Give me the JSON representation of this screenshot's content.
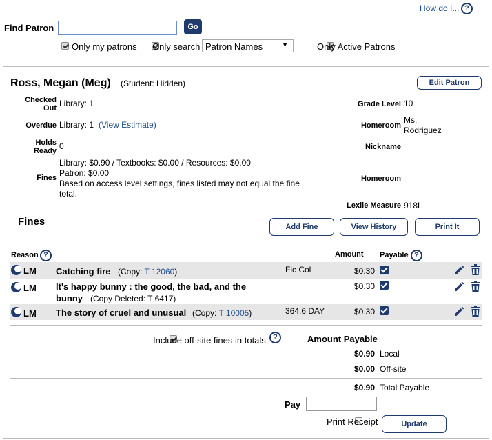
{
  "header": {
    "how_do_i": "How do I...",
    "find_patron_label": "Find Patron",
    "go_label": "Go",
    "only_my_patrons": "Only my patrons",
    "only_search": "Only search",
    "search_select": "Patron Names",
    "only_active": "Only Active Patrons"
  },
  "patron": {
    "name": "Ross, Megan (Meg)",
    "type": "(Student: Hidden)",
    "edit_label": "Edit Patron",
    "checked_out_label_1": "Checked",
    "checked_out_label_2": "Out",
    "checked_out_value": "Library: 1",
    "overdue_label": "Overdue",
    "overdue_value": "Library: 1",
    "view_estimate": "(View Estimate)",
    "holds_label_1": "Holds",
    "holds_label_2": "Ready",
    "holds_value": "0",
    "fines_label": "Fines",
    "fines_line1": "Library: $0.90 / Textbooks: $0.00 / Resources: $0.00",
    "fines_line2": "Patron: $0.00",
    "fines_line3": "Based on access level settings, fines listed may not equal the fine",
    "fines_line4": "total.",
    "grade_label": "Grade Level",
    "grade_value": "10",
    "homeroom_label": "Homeroom",
    "homeroom_value_1": "Ms.",
    "homeroom_value_2": "Rodriguez",
    "nickname_label": "Nickname",
    "homeroom2_label": "Homeroom",
    "lexile_label": "Lexile Measure",
    "lexile_value": "918L"
  },
  "fines": {
    "title": "Fines",
    "add_fine": "Add Fine",
    "view_history": "View History",
    "print_it": "Print It",
    "col_reason": "Reason",
    "col_amount": "Amount",
    "col_payable": "Payable",
    "rows": [
      {
        "reason": "LM",
        "title": "Catching fire",
        "copy_prefix": "(Copy: ",
        "copy": "T 12060",
        "copy_suffix": ")",
        "call": "Fic Col",
        "amount": "$0.30"
      },
      {
        "reason": "LM",
        "title_1": "It's happy bunny : the good, the bad, and the",
        "title_2": "bunny",
        "copy_text": "(Copy Deleted: T 6417)",
        "amount": "$0.30"
      },
      {
        "reason": "LM",
        "title": "The story of cruel and unusual",
        "copy_prefix": "(Copy: ",
        "copy": "T 10005",
        "copy_suffix": ")",
        "call": "364.6 DAY",
        "amount": "$0.30"
      }
    ]
  },
  "totals": {
    "include_offsite": "Include off-site fines in totals",
    "amount_payable": "Amount Payable",
    "local_amount": "$0.90",
    "local_label": "Local",
    "offsite_amount": "$0.00",
    "offsite_label": "Off-site",
    "total_amount": "$0.90",
    "total_label": "Total Payable",
    "pay_label": "Pay",
    "print_receipt": "Print Receipt",
    "update_label": "Update"
  }
}
